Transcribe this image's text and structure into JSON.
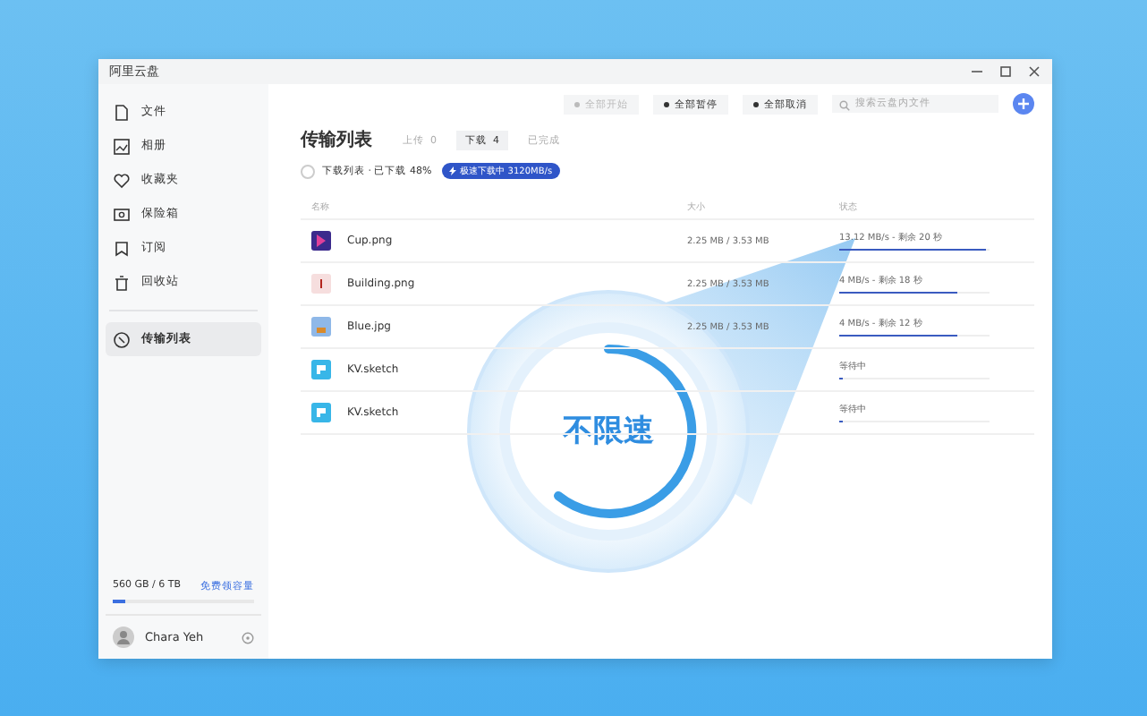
{
  "window": {
    "title": "阿里云盘"
  },
  "sidebar": {
    "items": [
      {
        "label": "文件",
        "selected": false
      },
      {
        "label": "相册",
        "selected": false
      },
      {
        "label": "收藏夹",
        "selected": false
      },
      {
        "label": "保险箱",
        "selected": false
      },
      {
        "label": "订阅",
        "selected": false
      },
      {
        "label": "回收站",
        "selected": false
      }
    ],
    "transfer": {
      "label": "传输列表",
      "selected": true
    },
    "storage": {
      "text": "560 GB / 6 TB",
      "link": "免费领容量",
      "level": 0.09
    },
    "user": {
      "name": "Chara Yeh"
    }
  },
  "toolbar": {
    "buttons": [
      {
        "label": "全部开始",
        "disabled": true
      },
      {
        "label": "全部暂停",
        "disabled": false
      },
      {
        "label": "全部取消",
        "disabled": false
      }
    ],
    "search": {
      "placeholder": "搜索云盘内文件"
    }
  },
  "page": {
    "title": "传输列表",
    "tabs": [
      {
        "label": "上传",
        "count": "0",
        "selected": false
      },
      {
        "label": "下载",
        "count": "4",
        "selected": true
      },
      {
        "label": "已完成",
        "selected": false
      }
    ],
    "select_all": {
      "checked": false
    },
    "summary": "下载列表 · 已下载 48%",
    "badge": "极速下载中 3120MB/s"
  },
  "table": {
    "columns": [
      "名称",
      "大小",
      "状态"
    ],
    "rows": [
      {
        "name": "Cup.png",
        "kind": "cup",
        "size": "2.25 MB / 3.53 MB",
        "status": "13.12 MB/s - 剩余 20 秒",
        "level": 0.98
      },
      {
        "name": "Building.png",
        "kind": "building",
        "size": "2.25 MB / 3.53 MB",
        "status": "4 MB/s - 剩余 18 秒",
        "level": 0.78
      },
      {
        "name": "Blue.jpg",
        "kind": "blue",
        "size": "2.25 MB / 3.53 MB",
        "status": "4 MB/s - 剩余 12 秒",
        "level": 0.78
      },
      {
        "name": "KV.sketch",
        "kind": "sketch",
        "status": "等待中",
        "level": 0.02
      },
      {
        "name": "KV.sketch",
        "kind": "sketch",
        "status": "等待中",
        "level": 0.02
      }
    ]
  },
  "overlay": {
    "label": "不限速"
  }
}
